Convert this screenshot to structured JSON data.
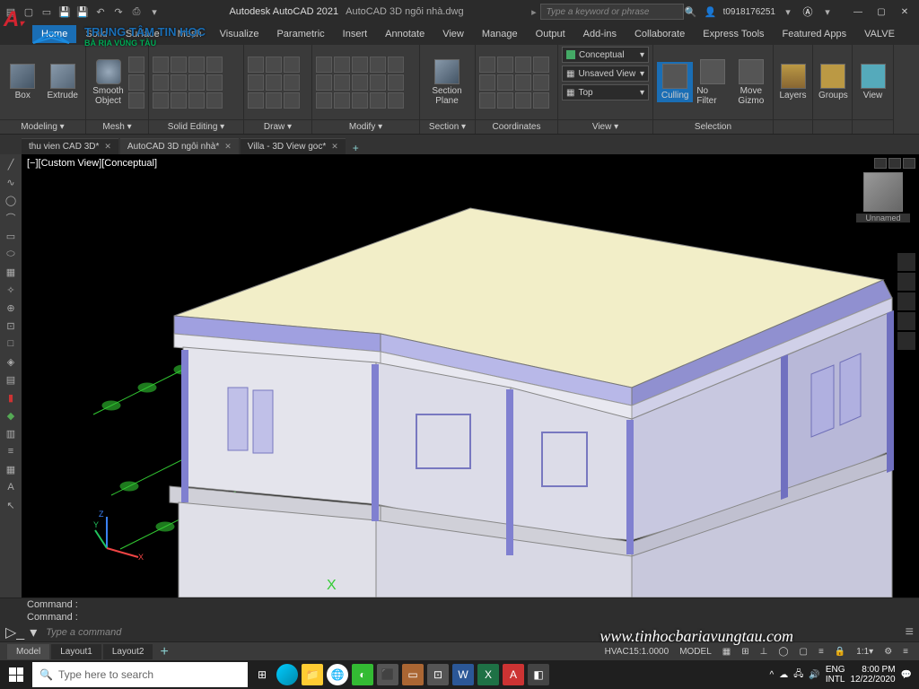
{
  "title": {
    "app": "Autodesk AutoCAD 2021",
    "file": "AutoCAD 3D ngôi nhà.dwg"
  },
  "search": {
    "placeholder": "Type a keyword or phrase"
  },
  "user": {
    "name": "t0918176251"
  },
  "ribbon": {
    "tabs": [
      "Home",
      "Solid",
      "Surface",
      "Mesh",
      "Visualize",
      "Parametric",
      "Insert",
      "Annotate",
      "View",
      "Manage",
      "Output",
      "Add-ins",
      "Collaborate",
      "Express Tools",
      "Featured Apps",
      "VALVE"
    ],
    "active": 0,
    "panels": {
      "modeling": {
        "label": "Modeling ▾",
        "box": "Box",
        "extrude": "Extrude"
      },
      "mesh": {
        "label": "Mesh ▾",
        "smooth": "Smooth Object"
      },
      "solidEditing": {
        "label": "Solid Editing ▾"
      },
      "draw": {
        "label": "Draw ▾"
      },
      "modify": {
        "label": "Modify ▾"
      },
      "section": {
        "label": "Section ▾",
        "plane": "Section Plane"
      },
      "coordinates": {
        "label": "Coordinates"
      },
      "view": {
        "label": "View ▾",
        "style": "Conceptual",
        "saved": "Unsaved View",
        "orient": "Top"
      },
      "selection": {
        "label": "Selection",
        "culling": "Culling",
        "nofilter": "No Filter",
        "gizmo": "Move Gizmo"
      },
      "layers": {
        "label": "Layers"
      },
      "groups": {
        "label": "Groups"
      },
      "viewP": {
        "label": "View"
      }
    }
  },
  "docTabs": [
    {
      "label": "thu vien CAD 3D*",
      "active": false
    },
    {
      "label": "AutoCAD 3D ngôi nhà*",
      "active": true
    },
    {
      "label": "Villa - 3D View goc*",
      "active": false
    }
  ],
  "viewport": {
    "label": "[−][Custom View][Conceptual]",
    "cubeLabel": "Unnamed"
  },
  "ucs": {
    "x": "X",
    "y": "Y",
    "z": "Z"
  },
  "cmd": {
    "history1": "Command :",
    "history2": "Command :",
    "placeholder": "Type a command"
  },
  "layoutTabs": [
    "Model",
    "Layout1",
    "Layout2"
  ],
  "status": {
    "hvac": "HVAC15:1.0000",
    "model": "MODEL"
  },
  "taskbar": {
    "search": "Type here to search",
    "lang": "ENG",
    "ime": "INTL",
    "time": "8:00 PM",
    "date": "12/22/2020"
  },
  "watermark": {
    "logo1": "TRUNG TÂM TIN HỌC",
    "logo2": "BÀ RỊA VŨNG TÀU",
    "url": "www.tinhocbariavungtau.com"
  }
}
